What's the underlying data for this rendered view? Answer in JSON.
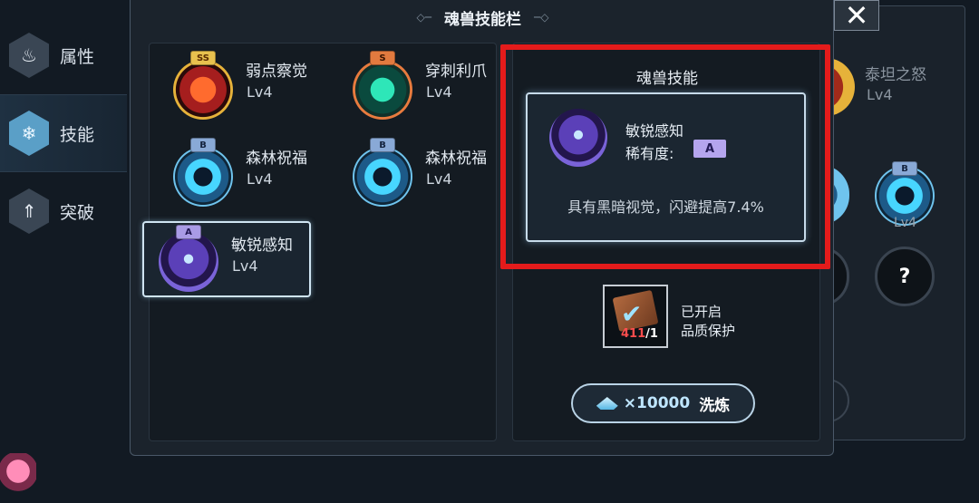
{
  "nav": {
    "items": [
      {
        "label": "属性",
        "icon": "flame-icon"
      },
      {
        "label": "技能",
        "icon": "snowflake-icon",
        "active": true
      },
      {
        "label": "突破",
        "icon": "arrow-up-icon"
      }
    ]
  },
  "modal": {
    "title": "魂兽技能栏",
    "skills": [
      {
        "name": "弱点察觉",
        "level": "Lv4",
        "rarity": "SS"
      },
      {
        "name": "穿刺利爪",
        "level": "Lv4",
        "rarity": "S"
      },
      {
        "name": "森林祝福",
        "level": "Lv4",
        "rarity": "B"
      },
      {
        "name": "森林祝福",
        "level": "Lv4",
        "rarity": "B"
      },
      {
        "name": "敏锐感知",
        "level": "Lv4",
        "rarity": "A",
        "selected": true
      }
    ],
    "detail": {
      "heading": "魂兽技能",
      "name": "敏锐感知",
      "rarity_label": "稀有度:",
      "rarity": "A",
      "description": "具有黑暗视觉，闪避提高7.4%"
    },
    "protection": {
      "owned": "411",
      "needed": "/1",
      "line1": "已开启",
      "line2": "品质保护"
    },
    "wash_button": {
      "cost": "×10000",
      "label": "洗炼"
    }
  },
  "background_panel": {
    "skill_name": "泰坦之怒",
    "skill_level": "Lv4",
    "badge": "B",
    "orb_level": "Lv4",
    "unknown_label": "?"
  },
  "colors": {
    "highlight": "#e41b1b",
    "rarity_a": "#b5a5ee",
    "rarity_ss": "#e8c14e",
    "rarity_s": "#e27a3f",
    "rarity_b": "#89a9d6"
  }
}
